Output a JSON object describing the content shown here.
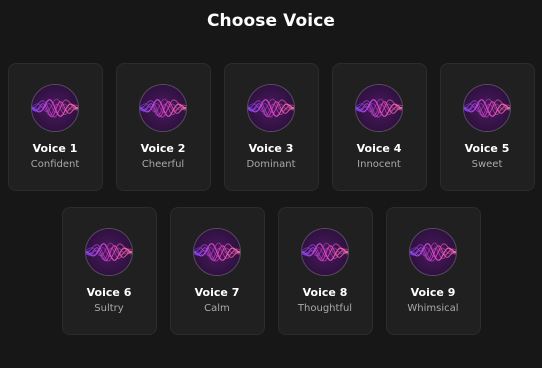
{
  "title": "Choose Voice",
  "accent_colors": {
    "wave_magenta": "#e040c8",
    "wave_violet": "#8a4dff",
    "wave_pink": "#ff6fa8",
    "avatar_bg": "#2a0f3a"
  },
  "voices": [
    {
      "name": "Voice 1",
      "desc": "Confident",
      "icon": "waveform-icon"
    },
    {
      "name": "Voice 2",
      "desc": "Cheerful",
      "icon": "waveform-icon"
    },
    {
      "name": "Voice 3",
      "desc": "Dominant",
      "icon": "waveform-icon"
    },
    {
      "name": "Voice 4",
      "desc": "Innocent",
      "icon": "waveform-icon"
    },
    {
      "name": "Voice 5",
      "desc": "Sweet",
      "icon": "waveform-icon"
    },
    {
      "name": "Voice 6",
      "desc": "Sultry",
      "icon": "waveform-icon"
    },
    {
      "name": "Voice 7",
      "desc": "Calm",
      "icon": "waveform-icon"
    },
    {
      "name": "Voice 8",
      "desc": "Thoughtful",
      "icon": "waveform-icon"
    },
    {
      "name": "Voice 9",
      "desc": "Whimsical",
      "icon": "waveform-icon"
    }
  ]
}
